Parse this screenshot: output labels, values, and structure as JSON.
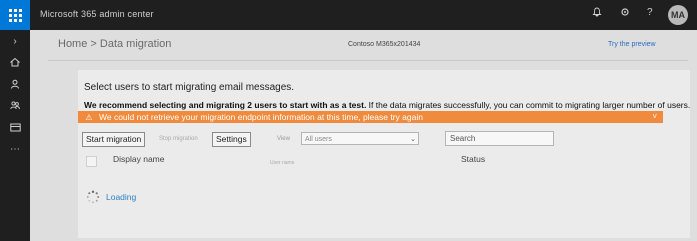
{
  "topbar": {
    "app_title": "Microsoft 365 admin center",
    "notification_icon": "bell-icon",
    "settings_icon": "gear-icon",
    "help_label": "?",
    "user_initials": "MA"
  },
  "nav": {
    "icons": [
      "chevron-right-icon",
      "home-icon",
      "user-icon",
      "groups-icon",
      "billing-icon",
      "more-icon"
    ]
  },
  "header": {
    "breadcrumb": "Home > Data migration",
    "tenant": "Contoso M365x201434",
    "try_preview": "Try the preview"
  },
  "main": {
    "instruction": "Select users to start migrating email messages.",
    "recommendation_bold": "We recommend selecting and migrating 2 users to start with as a test.",
    "recommendation_rest": " If the data migrates successfully, you can commit to migrating larger number of users.",
    "error_message": "We could not retrieve your migration endpoint information at this time, please try again",
    "error_close": "˅",
    "toolbar": {
      "start_migration": "Start migration",
      "stop_migration": "Stop migration",
      "settings": "Settings"
    },
    "view": {
      "label": "View",
      "value": "All users"
    },
    "search": {
      "placeholder": "Search"
    },
    "columns": {
      "display_name": "Display name",
      "user_hint": "User name",
      "status": "Status"
    },
    "loading": "Loading"
  },
  "colors": {
    "accent": "#0078d7",
    "error_bar": "#f08a3c",
    "link": "#2b6cc4"
  }
}
